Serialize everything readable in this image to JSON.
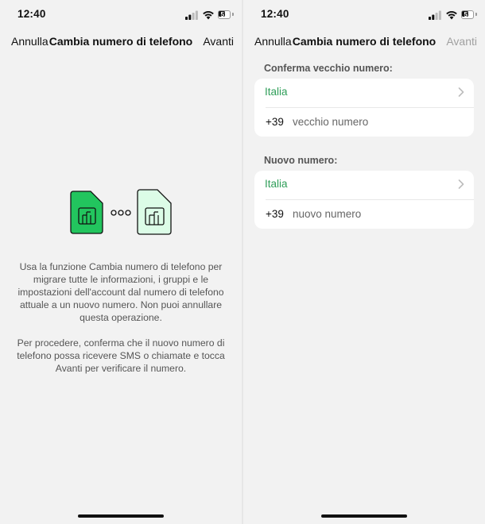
{
  "status": {
    "time": "12:40",
    "battery": "51"
  },
  "left": {
    "nav": {
      "cancel": "Annulla",
      "title": "Cambia numero di telefono",
      "next": "Avanti"
    },
    "description": [
      "Usa la funzione Cambia numero di telefono per migrare tutte le informazioni, i gruppi e le impostazioni dell'account dal numero di telefono attuale a un nuovo numero. Non puoi annullare questa operazione.",
      "Per procedere, conferma che il nuovo numero di telefono possa ricevere SMS o chiamate e tocca Avanti per verificare il numero."
    ]
  },
  "right": {
    "nav": {
      "cancel": "Annulla",
      "title": "Cambia numero di telefono",
      "next": "Avanti"
    },
    "old_section": {
      "label": "Conferma vecchio numero:",
      "country": "Italia",
      "prefix": "+39",
      "placeholder": "vecchio numero"
    },
    "new_section": {
      "label": "Nuovo numero:",
      "country": "Italia",
      "prefix": "+39",
      "placeholder": "nuovo numero"
    }
  },
  "colors": {
    "accent_green": "#2f9e59",
    "sim_green": "#22c55e",
    "sim_light": "#dcfce7",
    "disabled": "#a0a0a0"
  },
  "icons": [
    "signal-icon",
    "wifi-icon",
    "battery-icon",
    "sim-card-icon",
    "dots-icon",
    "chevron-right-icon"
  ]
}
